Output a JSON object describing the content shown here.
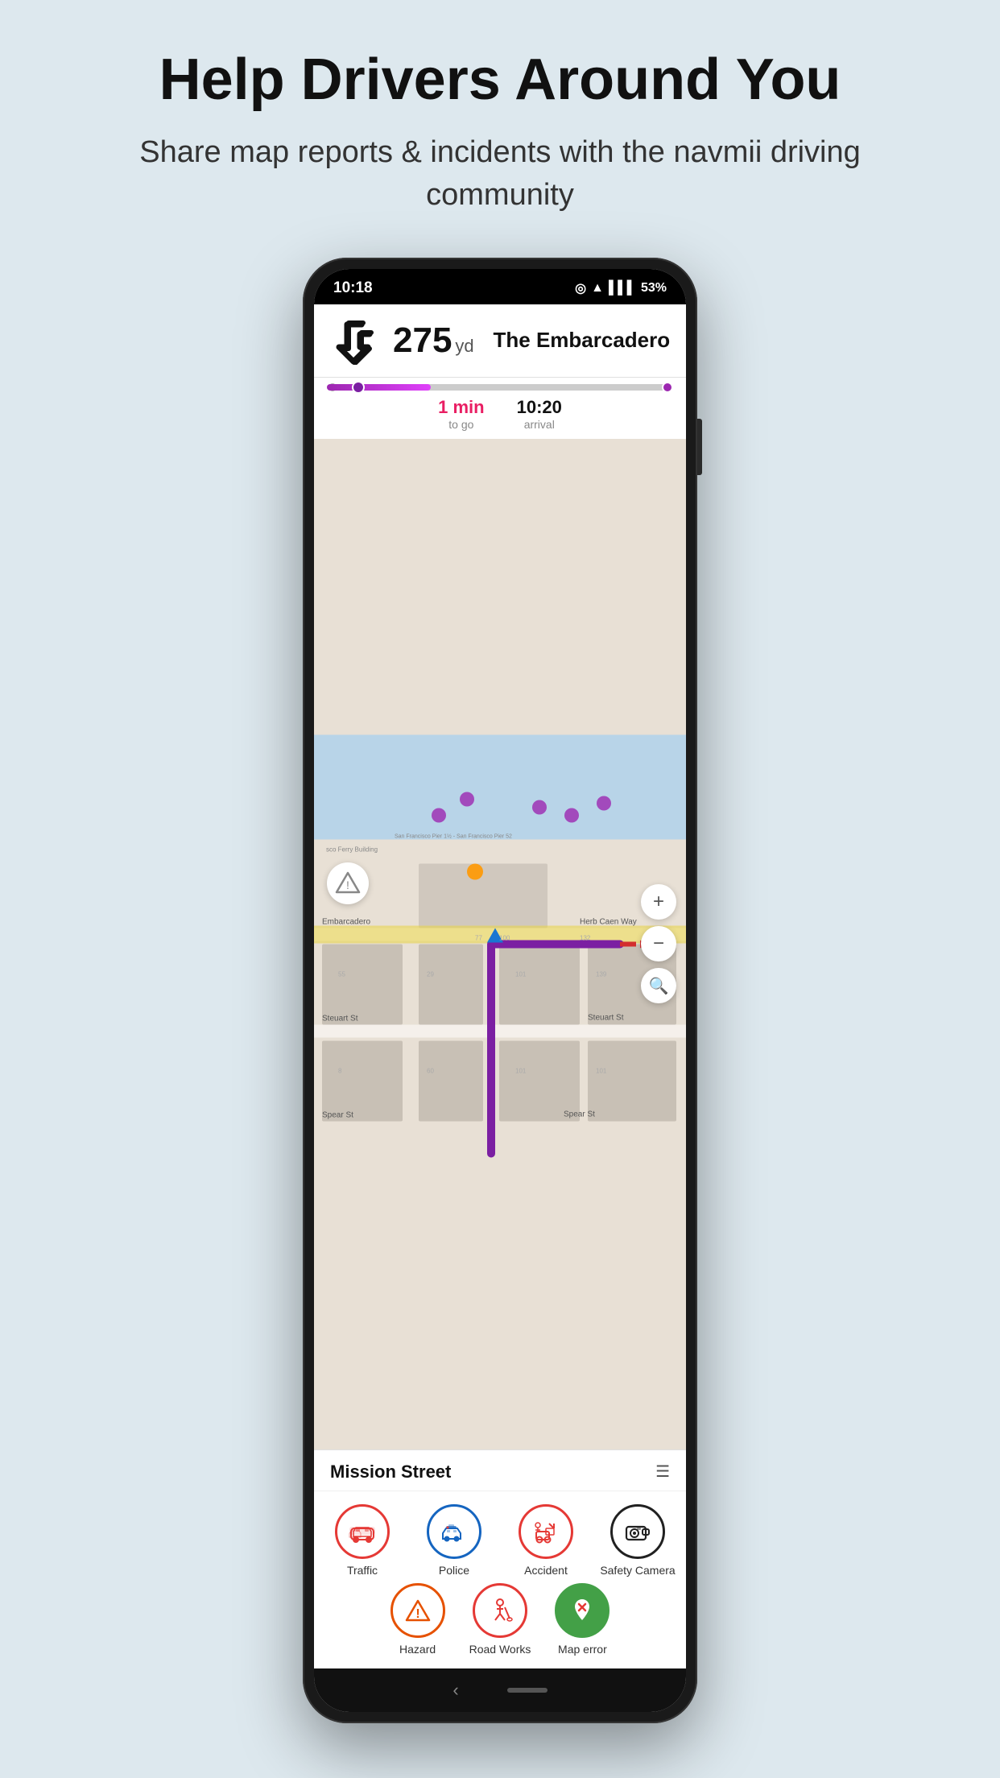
{
  "page": {
    "title": "Help Drivers Around You",
    "subtitle": "Share map reports & incidents with the navmii driving community"
  },
  "statusBar": {
    "time": "10:18",
    "battery": "53%"
  },
  "navigation": {
    "streetName": "The Embarcadero",
    "distance": "275",
    "distanceUnit": "yd",
    "timeToGo": "1",
    "timeUnit": "min",
    "timeLabel": "to go",
    "arrivalTime": "10:20",
    "arrivalLabel": "arrival"
  },
  "map": {
    "bottomStreet": "Mission Street",
    "zoomIn": "+",
    "zoomOut": "−",
    "searchIcon": "🔍"
  },
  "reportItems": {
    "row1": [
      {
        "id": "traffic",
        "label": "Traffic",
        "color": "#e53935",
        "emoji": "🚗"
      },
      {
        "id": "police",
        "label": "Police",
        "color": "#1565c0",
        "emoji": "🚓"
      },
      {
        "id": "accident",
        "label": "Accident",
        "color": "#e53935",
        "emoji": "🚧"
      },
      {
        "id": "safety-camera",
        "label": "Safety Camera",
        "color": "#212121",
        "emoji": "📷"
      }
    ],
    "row2": [
      {
        "id": "hazard",
        "label": "Hazard",
        "color": "#e65100",
        "emoji": "⚠"
      },
      {
        "id": "road-works",
        "label": "Road Works",
        "color": "#e53935",
        "emoji": "👷"
      },
      {
        "id": "map-error",
        "label": "Map error",
        "color": "#43a047",
        "emoji": "📍"
      }
    ]
  }
}
